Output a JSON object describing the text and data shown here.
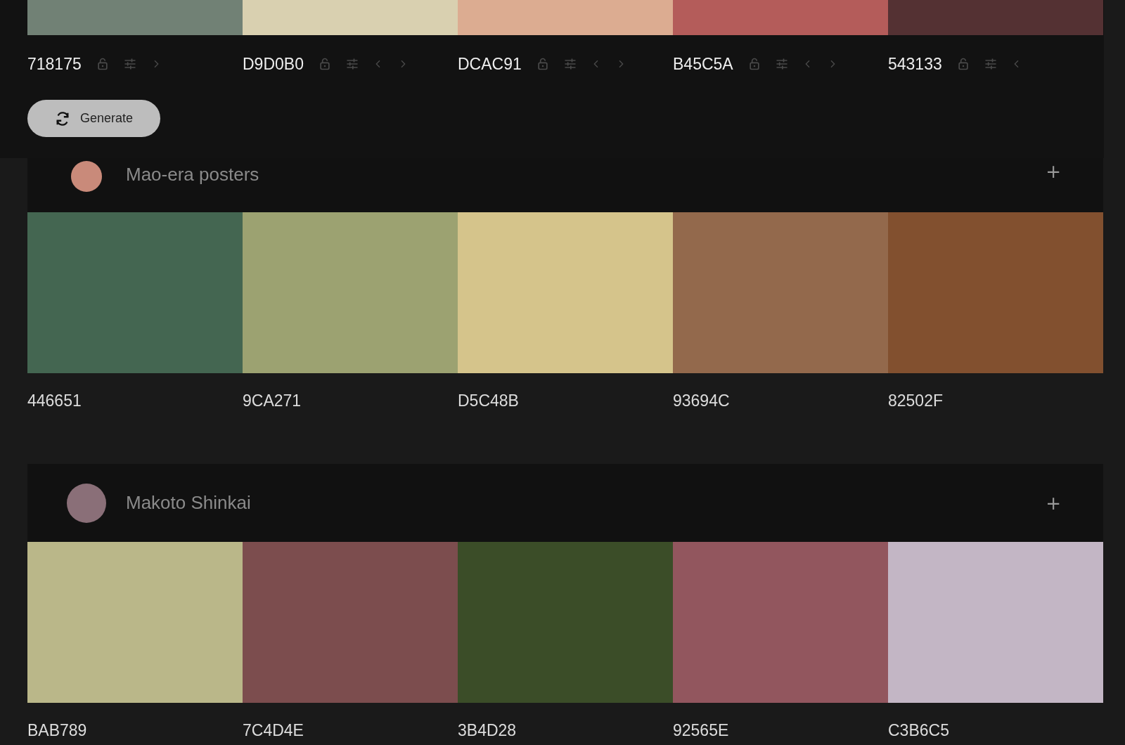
{
  "generator": {
    "swatches": [
      {
        "hex": "718175",
        "color": "#718175",
        "locked": false,
        "move_left": false,
        "move_right": true
      },
      {
        "hex": "D9D0B0",
        "color": "#d9d0b0",
        "locked": false,
        "move_left": true,
        "move_right": true
      },
      {
        "hex": "DCAC91",
        "color": "#dcac91",
        "locked": false,
        "move_left": true,
        "move_right": true
      },
      {
        "hex": "B45C5A",
        "color": "#b45c5a",
        "locked": false,
        "move_left": true,
        "move_right": true
      },
      {
        "hex": "543133",
        "color": "#543133",
        "locked": false,
        "move_left": true,
        "move_right": false
      }
    ],
    "button": "Generate"
  },
  "palettes": [
    {
      "title": "Mao-era posters",
      "add": "+",
      "swatches": [
        {
          "hex": "446651",
          "color": "#446651"
        },
        {
          "hex": "9CA271",
          "color": "#9ca271"
        },
        {
          "hex": "D5C48B",
          "color": "#d5c48b"
        },
        {
          "hex": "93694C",
          "color": "#93694c"
        },
        {
          "hex": "82502F",
          "color": "#82502f"
        }
      ]
    },
    {
      "title": "Makoto Shinkai",
      "add": "+",
      "swatches": [
        {
          "hex": "BAB789",
          "color": "#bab789"
        },
        {
          "hex": "7C4D4E",
          "color": "#7c4d4e"
        },
        {
          "hex": "3B4D28",
          "color": "#3b4d28"
        },
        {
          "hex": "92565E",
          "color": "#92565e"
        },
        {
          "hex": "C3B6C5",
          "color": "#c3b6c5"
        }
      ]
    }
  ]
}
